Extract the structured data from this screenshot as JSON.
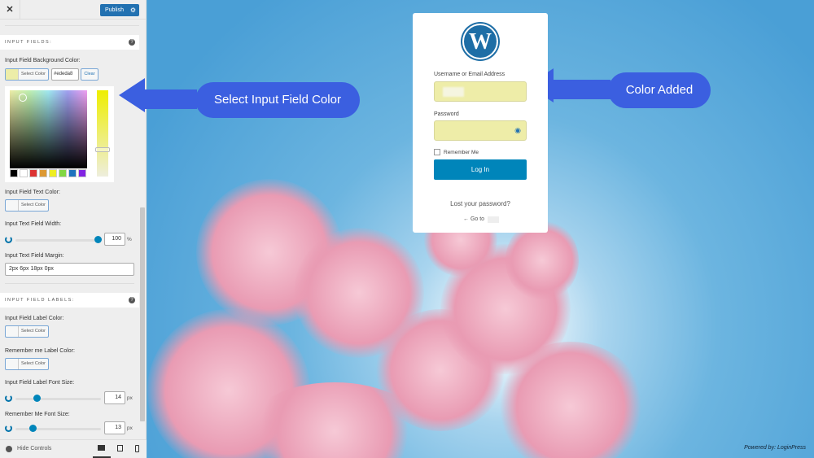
{
  "sidebar": {
    "close_label": "✕",
    "publish_label": "Publish",
    "sections": [
      {
        "title": "INPUT FIELDS:"
      },
      {
        "title": "INPUT FIELD LABELS:"
      }
    ],
    "bg_color": {
      "label": "Input Field Background Color:",
      "select": "Select Color",
      "value": "#ededa8",
      "clear": "Clear",
      "swatch": "#ededa8",
      "palette": [
        "#000000",
        "#ffffff",
        "#dd3333",
        "#dd9933",
        "#eeee22",
        "#81d742",
        "#1e73be",
        "#8224e3"
      ]
    },
    "text_color": {
      "label": "Input Field Text Color:",
      "select": "Select Color"
    },
    "width": {
      "label": "Input Text Field Width:",
      "value": "100",
      "unit": "%"
    },
    "margin": {
      "label": "Input Text Field Margin:",
      "value": "2px 6px 18px 0px"
    },
    "label_color": {
      "label": "Input Field Label Color:",
      "select": "Select Color"
    },
    "remember_color": {
      "label": "Remember me Label Color:",
      "select": "Select Color"
    },
    "label_size": {
      "label": "Input Field Label Font Size:",
      "value": "14",
      "unit": "px"
    },
    "remember_size": {
      "label": "Remember Me Font Size:",
      "value": "13",
      "unit": "px"
    },
    "hide_controls": "Hide Controls"
  },
  "callouts": {
    "left": "Select Input Field Color",
    "right": "Color Added"
  },
  "login": {
    "username_label": "Username or Email Address",
    "password_label": "Password",
    "remember": "Remember Me",
    "login_button": "Log In",
    "lost": "Lost your password?",
    "goto": "← Go to",
    "field_color": "#eeeda8"
  },
  "footer": {
    "powered": "Powered by: LoginPress"
  }
}
